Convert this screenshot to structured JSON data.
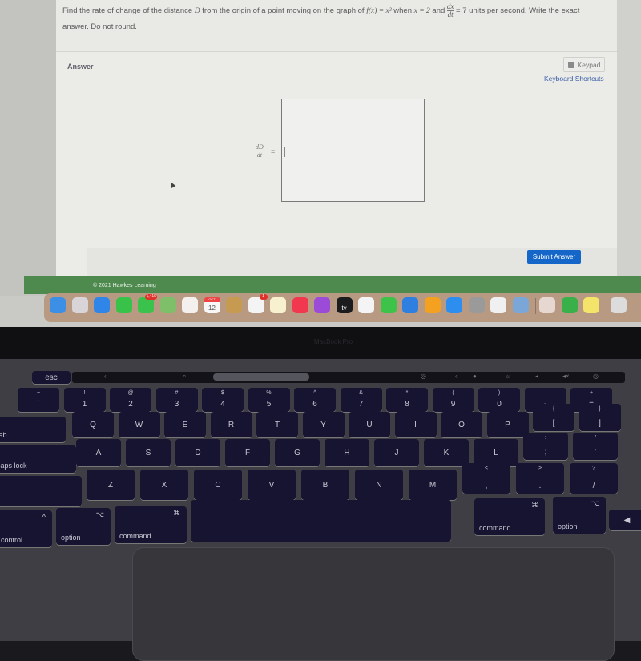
{
  "question": {
    "text_part1": "Find the rate of change of the distance ",
    "var_D": "D",
    "text_part2": " from the origin of a point moving on the graph of ",
    "function": "f(x) = x²",
    "text_part3": " when ",
    "condition_x": "x = 2",
    "text_part4": " and ",
    "rate_num": "dx",
    "rate_den": "dt",
    "text_part5": " = 7 units per second. Write the exact",
    "text_line2": "answer. Do not round."
  },
  "answer": {
    "label": "Answer",
    "keypad_label": "Keypad",
    "shortcuts_label": "Keyboard Shortcuts",
    "lhs_num": "dD",
    "lhs_den": "dt",
    "equals": "=",
    "input_value": "",
    "submit_label": "Submit Answer"
  },
  "footer": {
    "copyright": "© 2021 Hawkes Learning"
  },
  "dock": {
    "items": [
      {
        "name": "finder",
        "color": "#3d8fe6"
      },
      {
        "name": "launchpad",
        "color": "#d8d4d8"
      },
      {
        "name": "safari",
        "color": "#2f86e8"
      },
      {
        "name": "facetime",
        "color": "#38c24a"
      },
      {
        "name": "messages",
        "color": "#3ac24c",
        "badge": "1,415"
      },
      {
        "name": "maps",
        "color": "#7fbf6a"
      },
      {
        "name": "photos",
        "color": "#f3f0ee"
      },
      {
        "name": "calendar",
        "color": "#f7f7f7",
        "text": "12",
        "month": "OCT"
      },
      {
        "name": "contacts",
        "color": "#c79a52"
      },
      {
        "name": "reminders",
        "color": "#f4f4f4",
        "badge": "1"
      },
      {
        "name": "notes",
        "color": "#f7f1cf"
      },
      {
        "name": "music",
        "color": "#f2384e"
      },
      {
        "name": "podcasts",
        "color": "#9b4bd8"
      },
      {
        "name": "apple-tv",
        "color": "#1c1c1e",
        "text": "tv"
      },
      {
        "name": "news",
        "color": "#f4f4f4"
      },
      {
        "name": "numbers",
        "color": "#3dc24a"
      },
      {
        "name": "keynote",
        "color": "#2f7fe0"
      },
      {
        "name": "pages",
        "color": "#f4a020"
      },
      {
        "name": "app-store",
        "color": "#2e8ef0"
      },
      {
        "name": "system-preferences",
        "color": "#9a9a9a"
      },
      {
        "name": "chrome",
        "color": "#f0f0f0"
      },
      {
        "name": "preview",
        "color": "#7aa6d8"
      },
      {
        "name": "anatomy-app",
        "color": "#e6d8d0"
      },
      {
        "name": "find-my",
        "color": "#3ab04a"
      },
      {
        "name": "stickies",
        "color": "#f4e46a"
      },
      {
        "name": "trash",
        "color": "#dcdcdc"
      }
    ]
  },
  "device": {
    "label": "MacBook Pro"
  },
  "keyboard": {
    "esc": "esc",
    "number_row": [
      {
        "top": "~",
        "bot": "`"
      },
      {
        "top": "!",
        "bot": "1"
      },
      {
        "top": "@",
        "bot": "2"
      },
      {
        "top": "#",
        "bot": "3"
      },
      {
        "top": "$",
        "bot": "4"
      },
      {
        "top": "%",
        "bot": "5"
      },
      {
        "top": "^",
        "bot": "6"
      },
      {
        "top": "&",
        "bot": "7"
      },
      {
        "top": "*",
        "bot": "8"
      },
      {
        "top": "(",
        "bot": "9"
      },
      {
        "top": ")",
        "bot": "0"
      },
      {
        "top": "—",
        "bot": "-"
      },
      {
        "top": "+",
        "bot": "="
      }
    ],
    "tab": "tab",
    "row_q": [
      "Q",
      "W",
      "E",
      "R",
      "T",
      "Y",
      "U",
      "I",
      "O",
      "P"
    ],
    "row_q_extra": [
      {
        "top": "{",
        "bot": "["
      },
      {
        "top": "}",
        "bot": "]"
      }
    ],
    "caps": "caps lock",
    "row_a": [
      "A",
      "S",
      "D",
      "F",
      "G",
      "H",
      "J",
      "K",
      "L"
    ],
    "row_a_extra": [
      {
        "top": ":",
        "bot": ";"
      },
      {
        "top": "\"",
        "bot": "'"
      }
    ],
    "row_z": [
      "Z",
      "X",
      "C",
      "V",
      "B",
      "N",
      "M"
    ],
    "row_z_extra": [
      {
        "top": "<",
        "bot": ","
      },
      {
        "top": ">",
        "bot": "."
      },
      {
        "top": "?",
        "bot": "/"
      }
    ],
    "control": "control",
    "control_sym": "^",
    "option": "option",
    "option_sym": "⌥",
    "command": "command",
    "command_sym": "⌘",
    "arrow_left": "◀"
  }
}
